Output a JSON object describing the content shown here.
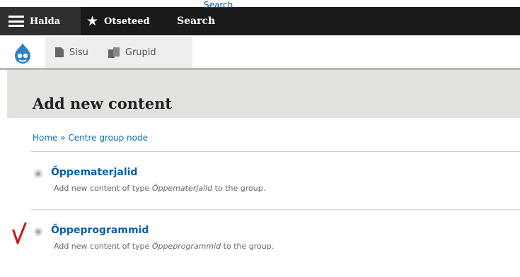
{
  "toolbar": {
    "manage_label": "Halda",
    "shortcuts_label": "Otseteed",
    "search_link": "Search",
    "search_label": "Search"
  },
  "tray": {
    "tabs": [
      {
        "label": "Sisu",
        "icon": "file-icon"
      },
      {
        "label": "Grupid",
        "icon": "group-icon"
      }
    ]
  },
  "page": {
    "title": "Add new content",
    "breadcrumb": "Home » Centre group node"
  },
  "items": [
    {
      "title": "Õppematerjalid",
      "desc_prefix": "Add new content of type ",
      "desc_type": "Õppematerjalid",
      "desc_suffix": " to the group."
    },
    {
      "title": "Õppeprogrammid",
      "desc_prefix": "Add new content of type ",
      "desc_type": "Õppeprogrammid",
      "desc_suffix": " to the group."
    }
  ],
  "annotation": {
    "checkmark_color": "#d0101a"
  },
  "colors": {
    "toolbar_bg": "#1a1a1a",
    "link": "#0a5ea8",
    "header_band": "#e4e2de"
  }
}
